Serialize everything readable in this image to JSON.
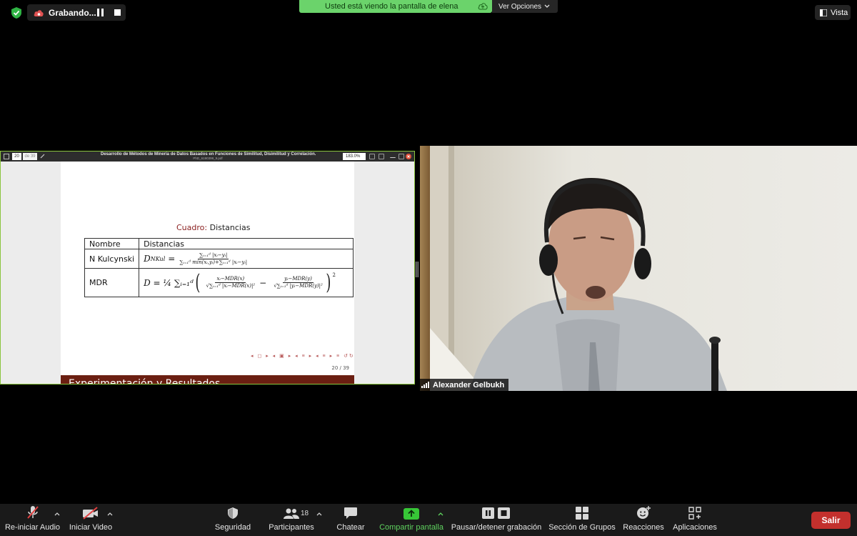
{
  "top_bar": {
    "recording_label": "Grabando...",
    "share_banner": "Usted está viendo la pantalla de elena",
    "view_options": "Ver Opciones",
    "view_button": "Vista"
  },
  "shared_screen": {
    "pdf_toolbar": {
      "page": "20",
      "total": "de 39",
      "title": "Desarrollo de Métodos de Minería de Datos Basados en Funciones de Similitud, Disimilitud y Correlación.",
      "filename": "PhD_6190399_9.pdf",
      "zoom": "183.0%"
    },
    "slide": {
      "caption_key": "Cuadro:",
      "caption_text": "Distancias",
      "table": {
        "headers": [
          "Nombre",
          "Distancias"
        ],
        "rows": [
          {
            "name": "N Kulcynski",
            "formula_lhs": "D",
            "formula_sub": "NKul",
            "formula_num": "∑ᵢ₌₁ᵈ |xᵢ−yᵢ|",
            "formula_den": "∑ᵢ₌₁ᵈ min(xᵢ,yᵢ)+∑ᵢ₌₁ᵈ |xᵢ−yᵢ|"
          },
          {
            "name": "MDR",
            "formula_lhs": "D = ¼ ∑ᵢ₌₁ᵈ",
            "frac1_num": "xᵢ−MDR(x)",
            "frac1_den": "√∑ᵢ₌₁ᵈ |xᵢ−MDR(x)|²",
            "frac2_num": "yᵢ−MDR(y)",
            "frac2_den": "√∑ᵢ₌₁ᵈ |yᵢ−MDR(y)|²",
            "exponent": "2"
          }
        ]
      },
      "page_number": "20 / 39",
      "next_slide_title": "Experimentación y Resultados"
    }
  },
  "speaker": {
    "name": "Alexander Gelbukh"
  },
  "toolbar": {
    "audio_label": "Re-iniciar Audio",
    "video_label": "Iniciar Video",
    "security_label": "Seguridad",
    "participants_label": "Participantes",
    "participants_count": "18",
    "chat_label": "Chatear",
    "share_label": "Compartir pantalla",
    "record_label": "Pausar/detener grabación",
    "breakout_label": "Sección de Grupos",
    "reactions_label": "Reacciones",
    "apps_label": "Aplicaciones",
    "exit_label": "Salir"
  },
  "colors": {
    "share_green": "#6bd36b",
    "exit_red": "#c3302d",
    "slide_header": "#6b1f12"
  }
}
